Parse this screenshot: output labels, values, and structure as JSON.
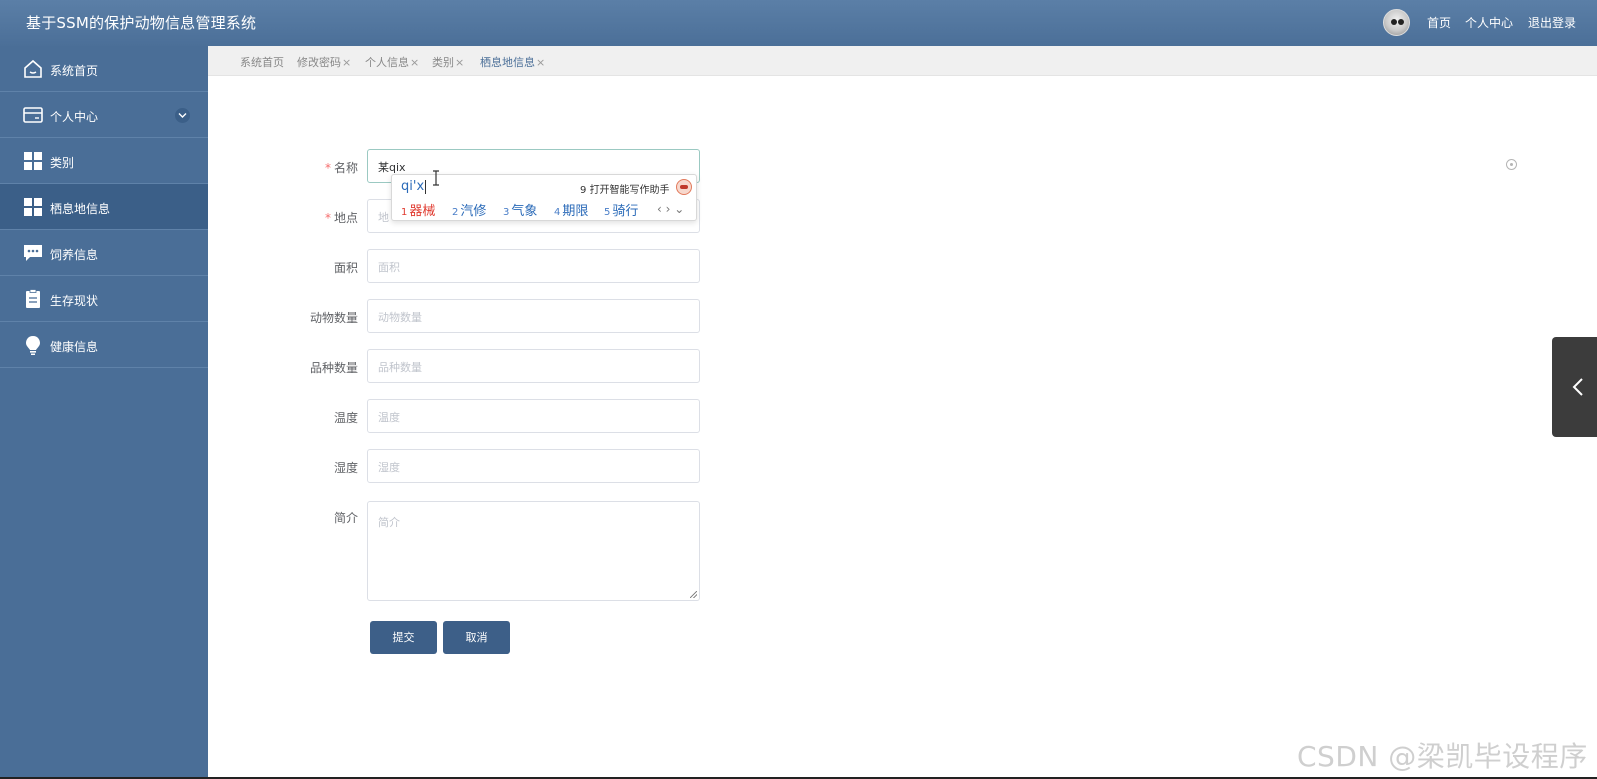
{
  "header": {
    "title": "基于SSM的保护动物信息管理系统",
    "nav": [
      "首页",
      "个人中心",
      "退出登录"
    ]
  },
  "sidebar": {
    "items": [
      {
        "label": "系统首页",
        "icon": "home-icon"
      },
      {
        "label": "个人中心",
        "icon": "wallet-icon",
        "expandable": true
      },
      {
        "label": "类别",
        "icon": "grid-icon"
      },
      {
        "label": "栖息地信息",
        "icon": "grid-icon",
        "active": true
      },
      {
        "label": "饲养信息",
        "icon": "chat-icon"
      },
      {
        "label": "生存现状",
        "icon": "clipboard-icon"
      },
      {
        "label": "健康信息",
        "icon": "bulb-icon"
      }
    ]
  },
  "tabs": [
    {
      "label": "系统首页",
      "closable": false
    },
    {
      "label": "修改密码",
      "closable": true
    },
    {
      "label": "个人信息",
      "closable": true
    },
    {
      "label": "类别",
      "closable": true
    },
    {
      "label": "栖息地信息",
      "closable": true,
      "active": true
    }
  ],
  "tab_close_glyph": "×",
  "form": {
    "name": {
      "label": "名称",
      "required": true,
      "value": "某qix"
    },
    "location": {
      "label": "地点",
      "required": true,
      "placeholder": "地"
    },
    "area": {
      "label": "面积",
      "placeholder": "面积"
    },
    "animal_count": {
      "label": "动物数量",
      "placeholder": "动物数量"
    },
    "species_count": {
      "label": "品种数量",
      "placeholder": "品种数量"
    },
    "temperature": {
      "label": "温度",
      "placeholder": "温度"
    },
    "humidity": {
      "label": "湿度",
      "placeholder": "湿度"
    },
    "intro": {
      "label": "简介",
      "placeholder": "简介"
    },
    "required_mark": "*",
    "submit_label": "提交",
    "cancel_label": "取消"
  },
  "ime": {
    "composition": "qi'x",
    "assistant_num": "9",
    "assistant_text": "打开智能写作助手",
    "candidates": [
      {
        "num": "1",
        "text": "器械"
      },
      {
        "num": "2",
        "text": "汽修"
      },
      {
        "num": "3",
        "text": "气象"
      },
      {
        "num": "4",
        "text": "期限"
      },
      {
        "num": "5",
        "text": "骑行"
      }
    ],
    "arrows": "‹ › ⌄"
  },
  "watermark": "CSDN @梁凯毕设程序"
}
